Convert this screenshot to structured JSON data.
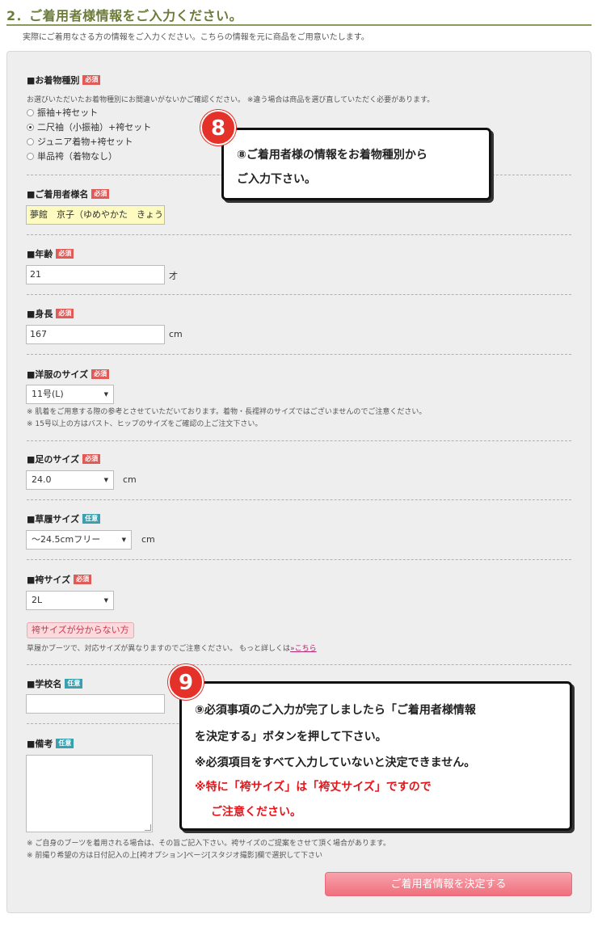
{
  "header": {
    "title": "2．ご着用者様情報をご入力ください。",
    "intro": "実際にご着用なさる方の情報をご入力ください。こちらの情報を元に商品をご用意いたします。"
  },
  "badges": {
    "required": "必須",
    "optional": "任意"
  },
  "kimono_type": {
    "label": "■お着物種別",
    "note": "お選びいただいたお着物種別にお間違いがないかご確認ください。 ※違う場合は商品を選び直していただく必要があります。",
    "options": [
      "振袖+袴セット",
      "二尺袖（小振袖）+袴セット",
      "ジュニア着物+袴セット",
      "単品袴（着物なし）"
    ],
    "selected_index": 1
  },
  "wearer_name": {
    "label": "■ご着用者様名",
    "value": "夢館　京子（ゆめやかた　きょうこ）"
  },
  "age": {
    "label": "■年齢",
    "value": "21",
    "unit": "才"
  },
  "height": {
    "label": "■身長",
    "value": "167",
    "unit": "cm"
  },
  "clothing_size": {
    "label": "■洋服のサイズ",
    "value": "11号(L)",
    "notes": [
      "※ 肌着をご用意する際の参考とさせていただいております。着物・長襦袢のサイズではございませんのでご注意ください。",
      "※ 15号以上の方はバスト、ヒップのサイズをご確認の上ご注文下さい。"
    ]
  },
  "foot_size": {
    "label": "■足のサイズ",
    "value": "24.0",
    "unit": "cm"
  },
  "zori_size": {
    "label": "■草履サイズ",
    "value": "～24.5cmフリー",
    "unit": "cm"
  },
  "hakama_size": {
    "label": "■袴サイズ",
    "value": "2L",
    "help_button": "袴サイズが分からない方",
    "note_prefix": "草履かブーツで、対応サイズが異なりますのでご注意ください。 もっと詳しくは",
    "note_link": "»こちら"
  },
  "school_name": {
    "label": "■学校名",
    "value": ""
  },
  "remarks": {
    "label": "■備考",
    "notes": [
      "※ ご自身のブーツを着用される場合は、その旨ご記入下さい。袴サイズのご提案をさせて頂く場合があります。",
      "※ 前撮り希望の方は日付記入の上[袴オプション]ページ[スタジオ撮影]欄で選択して下さい"
    ]
  },
  "submit_button": "ご着用者情報を決定する",
  "callout_8": {
    "number": "8",
    "lines": [
      "⑧ご着用者様の情報をお着物種別から",
      "ご入力下さい。"
    ]
  },
  "callout_9": {
    "number": "9",
    "lines": [
      "⑨必須事項のご入力が完了しましたら「ご着用者様情報",
      "を決定する」ボタンを押して下さい。",
      "※必須項目をすべて入力していないと決定できません。"
    ],
    "red_lines": [
      "※特に「袴サイズ」は「袴丈サイズ」ですので",
      "ご注意ください。"
    ]
  },
  "colors": {
    "title": "#6b7b3a",
    "required_badge": "#e05b57",
    "optional_badge": "#3aa0b0",
    "callout_number": "#e4322b",
    "submit": "#ef6f7d"
  }
}
